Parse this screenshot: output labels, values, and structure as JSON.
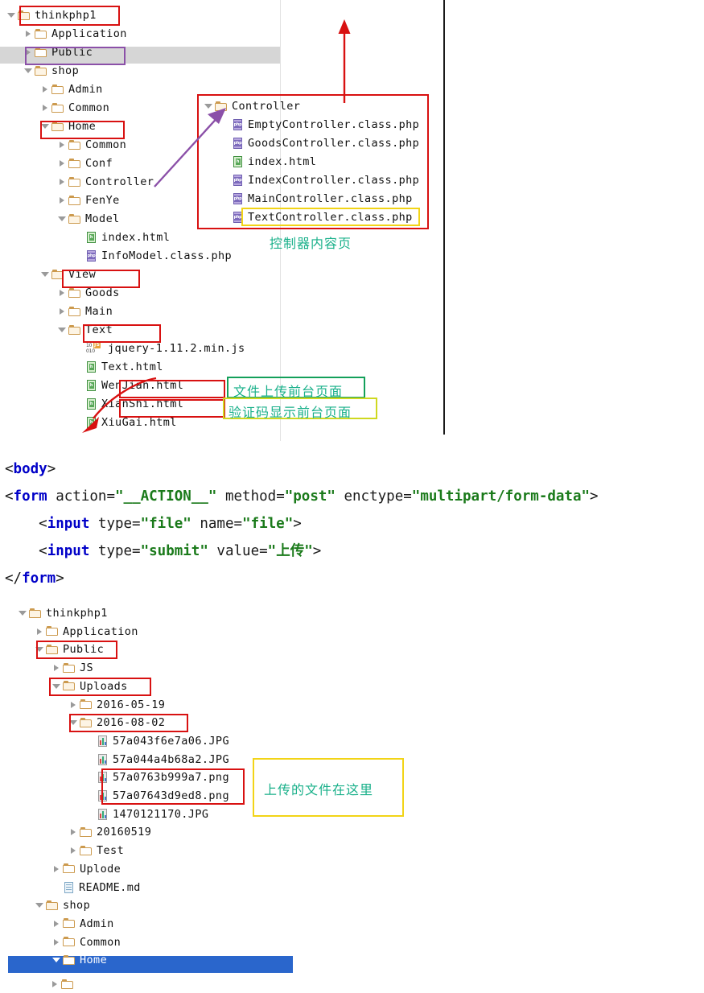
{
  "meta": {
    "title": "ThinkPHP project explorer with upload form code"
  },
  "panel_top": {
    "name": "project-tree-top",
    "rows": [
      {
        "indent": 0,
        "caret": "down",
        "icon": "folder",
        "label": "thinkphp1"
      },
      {
        "indent": 1,
        "caret": "right",
        "icon": "folder",
        "label": "Application"
      },
      {
        "indent": 1,
        "caret": "right",
        "icon": "folder",
        "label": "Public"
      },
      {
        "indent": 1,
        "caret": "down",
        "icon": "folder",
        "label": "shop"
      },
      {
        "indent": 2,
        "caret": "right",
        "icon": "folder",
        "label": "Admin"
      },
      {
        "indent": 2,
        "caret": "right",
        "icon": "folder",
        "label": "Common"
      },
      {
        "indent": 2,
        "caret": "down",
        "icon": "folder",
        "label": "Home"
      },
      {
        "indent": 3,
        "caret": "right",
        "icon": "folder",
        "label": "Common"
      },
      {
        "indent": 3,
        "caret": "right",
        "icon": "folder",
        "label": "Conf"
      },
      {
        "indent": 3,
        "caret": "right",
        "icon": "folder",
        "label": "Controller"
      },
      {
        "indent": 3,
        "caret": "right",
        "icon": "folder",
        "label": "FenYe"
      },
      {
        "indent": 3,
        "caret": "down",
        "icon": "folder",
        "label": "Model"
      },
      {
        "indent": 4,
        "caret": "none",
        "icon": "html",
        "label": "index.html"
      },
      {
        "indent": 4,
        "caret": "none",
        "icon": "php",
        "label": "InfoModel.class.php"
      },
      {
        "indent": 2,
        "caret": "down",
        "icon": "folder",
        "label": "View"
      },
      {
        "indent": 3,
        "caret": "right",
        "icon": "folder",
        "label": "Goods"
      },
      {
        "indent": 3,
        "caret": "right",
        "icon": "folder",
        "label": "Main"
      },
      {
        "indent": 3,
        "caret": "down",
        "icon": "folder",
        "label": "Text"
      },
      {
        "indent": 4,
        "caret": "none",
        "icon": "js",
        "label": "jquery-1.11.2.min.js"
      },
      {
        "indent": 4,
        "caret": "none",
        "icon": "html",
        "label": "Text.html"
      },
      {
        "indent": 4,
        "caret": "none",
        "icon": "html",
        "label": "WenJian.html"
      },
      {
        "indent": 4,
        "caret": "none",
        "icon": "html",
        "label": "XianShi.html"
      },
      {
        "indent": 4,
        "caret": "none",
        "icon": "html",
        "label": "XiuGai.html"
      }
    ]
  },
  "panel_controller": {
    "name": "controller-folder-detail",
    "rows": [
      {
        "indent": 0,
        "caret": "down",
        "icon": "folder",
        "label": "Controller"
      },
      {
        "indent": 1,
        "caret": "none",
        "icon": "php",
        "label": "EmptyController.class.php"
      },
      {
        "indent": 1,
        "caret": "none",
        "icon": "php",
        "label": "GoodsController.class.php"
      },
      {
        "indent": 1,
        "caret": "none",
        "icon": "html",
        "label": "index.html"
      },
      {
        "indent": 1,
        "caret": "none",
        "icon": "php",
        "label": "IndexController.class.php"
      },
      {
        "indent": 1,
        "caret": "none",
        "icon": "php",
        "label": "MainController.class.php"
      },
      {
        "indent": 1,
        "caret": "none",
        "icon": "php",
        "label": "TextController.class.php"
      }
    ]
  },
  "annotations": {
    "controller_caption": "控制器内容页",
    "wenjian_caption": "文件上传前台页面",
    "xianshi_caption": "验证码显示前台页面",
    "uploads_caption": "上传的文件在这里"
  },
  "code": {
    "lines": [
      [
        {
          "t": "<",
          "c": "pn"
        },
        {
          "t": "body",
          "c": "kw"
        },
        {
          "t": ">",
          "c": "pn"
        }
      ],
      [
        {
          "t": "<",
          "c": "pn"
        },
        {
          "t": "form",
          "c": "kw"
        },
        {
          "t": " action=",
          "c": "at"
        },
        {
          "t": "\"__ACTION__\"",
          "c": "st"
        },
        {
          "t": " method=",
          "c": "at"
        },
        {
          "t": "\"post\"",
          "c": "st"
        },
        {
          "t": " enctype=",
          "c": "at"
        },
        {
          "t": "\"multipart/form-data\"",
          "c": "st"
        },
        {
          "t": ">",
          "c": "pn"
        }
      ],
      [
        {
          "t": "    <",
          "c": "pn"
        },
        {
          "t": "input",
          "c": "kw"
        },
        {
          "t": " type=",
          "c": "at"
        },
        {
          "t": "\"file\"",
          "c": "st"
        },
        {
          "t": " name=",
          "c": "at"
        },
        {
          "t": "\"file\"",
          "c": "st"
        },
        {
          "t": ">",
          "c": "pn"
        }
      ],
      [
        {
          "t": "    <",
          "c": "pn"
        },
        {
          "t": "input",
          "c": "kw"
        },
        {
          "t": " type=",
          "c": "at"
        },
        {
          "t": "\"submit\"",
          "c": "st"
        },
        {
          "t": " value=",
          "c": "at"
        },
        {
          "t": "\"上传\"",
          "c": "st"
        },
        {
          "t": ">",
          "c": "pn"
        }
      ],
      [
        {
          "t": "</",
          "c": "pn"
        },
        {
          "t": "form",
          "c": "kw"
        },
        {
          "t": ">",
          "c": "pn"
        }
      ]
    ]
  },
  "panel_bottom": {
    "name": "project-tree-bottom",
    "rows": [
      {
        "indent": 0,
        "caret": "down",
        "icon": "folder",
        "label": "thinkphp1"
      },
      {
        "indent": 1,
        "caret": "right",
        "icon": "folder",
        "label": "Application"
      },
      {
        "indent": 1,
        "caret": "down",
        "icon": "folder",
        "label": "Public"
      },
      {
        "indent": 2,
        "caret": "right",
        "icon": "folder",
        "label": "JS"
      },
      {
        "indent": 2,
        "caret": "down",
        "icon": "folder",
        "label": "Uploads"
      },
      {
        "indent": 3,
        "caret": "right",
        "icon": "folder",
        "label": "2016-05-19"
      },
      {
        "indent": 3,
        "caret": "down",
        "icon": "folder",
        "label": "2016-08-02"
      },
      {
        "indent": 4,
        "caret": "none",
        "icon": "img",
        "label": "57a043f6e7a06.JPG"
      },
      {
        "indent": 4,
        "caret": "none",
        "icon": "img",
        "label": "57a044a4b68a2.JPG"
      },
      {
        "indent": 4,
        "caret": "none",
        "icon": "img",
        "label": "57a0763b999a7.png"
      },
      {
        "indent": 4,
        "caret": "none",
        "icon": "img",
        "label": "57a07643d9ed8.png"
      },
      {
        "indent": 4,
        "caret": "none",
        "icon": "img",
        "label": "1470121170.JPG"
      },
      {
        "indent": 3,
        "caret": "right",
        "icon": "folder",
        "label": "20160519"
      },
      {
        "indent": 3,
        "caret": "right",
        "icon": "folder",
        "label": "Test"
      },
      {
        "indent": 2,
        "caret": "right",
        "icon": "folder",
        "label": "Uplode"
      },
      {
        "indent": 2,
        "caret": "none",
        "icon": "md",
        "label": "README.md"
      },
      {
        "indent": 1,
        "caret": "down",
        "icon": "folder",
        "label": "shop"
      },
      {
        "indent": 2,
        "caret": "right",
        "icon": "folder",
        "label": "Admin"
      },
      {
        "indent": 2,
        "caret": "right",
        "icon": "folder",
        "label": "Common"
      },
      {
        "indent": 2,
        "caret": "down",
        "icon": "folder",
        "label": "Home",
        "selected": true
      }
    ]
  },
  "colors": {
    "red_mark": "#d81111",
    "purple_mark": "#8b50a8",
    "yellow_mark": "#f2d417",
    "green_mark": "#13a05a",
    "teal_text": "#19b08a",
    "selection_blue": "#2a66cc",
    "hover_gray": "#d6d6d6",
    "folder_gold": "#cc9a4e"
  }
}
